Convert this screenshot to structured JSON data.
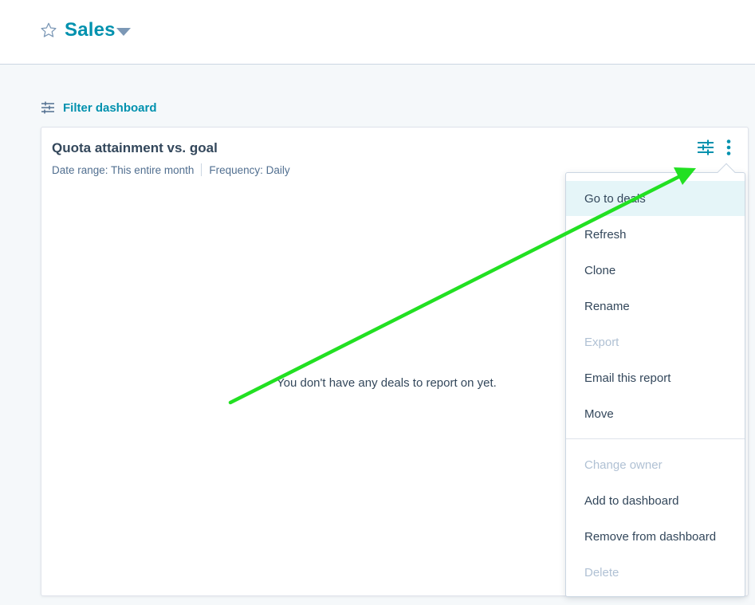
{
  "header": {
    "title": "Sales",
    "star_icon": "star-outline-icon",
    "caret_icon": "caret-down-icon"
  },
  "filter": {
    "label": "Filter dashboard",
    "icon": "sliders-icon"
  },
  "report": {
    "title": "Quota attainment vs. goal",
    "date_range": "Date range: This entire month",
    "frequency": "Frequency: Daily",
    "empty_message": "You don't have any deals to report on yet.",
    "actions": [
      "sliders-icon",
      "more-vertical-icon"
    ]
  },
  "menu": {
    "items": [
      {
        "label": "Go to deals",
        "state": "hover"
      },
      {
        "label": "Refresh",
        "state": "enabled"
      },
      {
        "label": "Clone",
        "state": "enabled"
      },
      {
        "label": "Rename",
        "state": "enabled"
      },
      {
        "label": "Export",
        "state": "disabled"
      },
      {
        "label": "Email this report",
        "state": "enabled"
      },
      {
        "label": "Move",
        "state": "enabled"
      },
      {
        "label": "Change owner",
        "state": "disabled"
      },
      {
        "label": "Add to dashboard",
        "state": "enabled"
      },
      {
        "label": "Remove from dashboard",
        "state": "enabled"
      },
      {
        "label": "Delete",
        "state": "disabled"
      }
    ]
  },
  "annotation": {
    "type": "arrow",
    "color": "#22e022"
  },
  "colors": {
    "accent": "#0091ae",
    "text": "#33475b",
    "muted": "#516f90",
    "disabled": "#b0c1d4",
    "hover": "#e5f5f8",
    "background": "#f5f8fa"
  }
}
